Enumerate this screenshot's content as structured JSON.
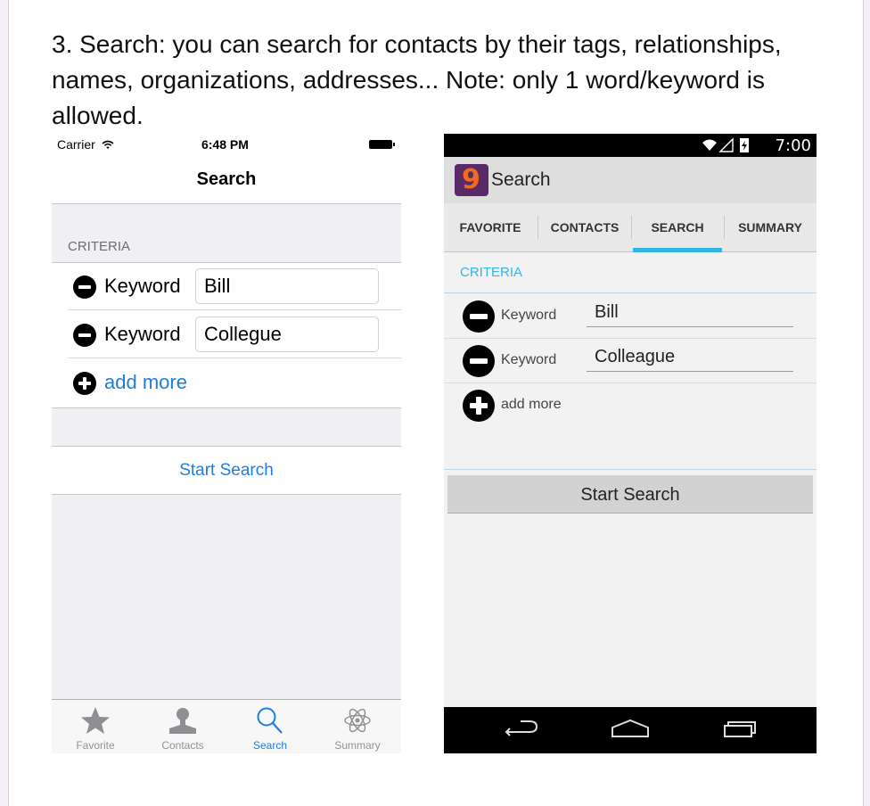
{
  "heading": "3. Search: you can search for contacts by their tags, relationships, names, organizations, addresses... Note: only 1 word/keyword is allowed.",
  "ios": {
    "status": {
      "carrier": "Carrier",
      "time": "6:48 PM"
    },
    "nav_title": "Search",
    "section_header": "CRITERIA",
    "rows": [
      {
        "label": "Keyword",
        "value": "Bill"
      },
      {
        "label": "Keyword",
        "value": "Collegue"
      }
    ],
    "add_more": "add more",
    "start_search": "Start Search",
    "tabs": [
      {
        "label": "Favorite",
        "icon": "star-icon"
      },
      {
        "label": "Contacts",
        "icon": "person-icon"
      },
      {
        "label": "Search",
        "icon": "magnifier-icon",
        "active": true
      },
      {
        "label": "Summary",
        "icon": "atom-icon"
      }
    ],
    "accent_color": "#1e7ee0"
  },
  "android": {
    "status": {
      "time": "7:00"
    },
    "app_logo": "9",
    "action_title": "Search",
    "tabs": [
      {
        "label": "FAVORITE"
      },
      {
        "label": "CONTACTS"
      },
      {
        "label": "SEARCH",
        "active": true
      },
      {
        "label": "SUMMARY"
      }
    ],
    "section_header": "CRITERIA",
    "rows": [
      {
        "label": "Keyword",
        "value": "Bill"
      },
      {
        "label": "Keyword",
        "value": "Colleague"
      }
    ],
    "add_more": "add more",
    "start_search": "Start Search",
    "accent_color": "#33b5e5"
  }
}
